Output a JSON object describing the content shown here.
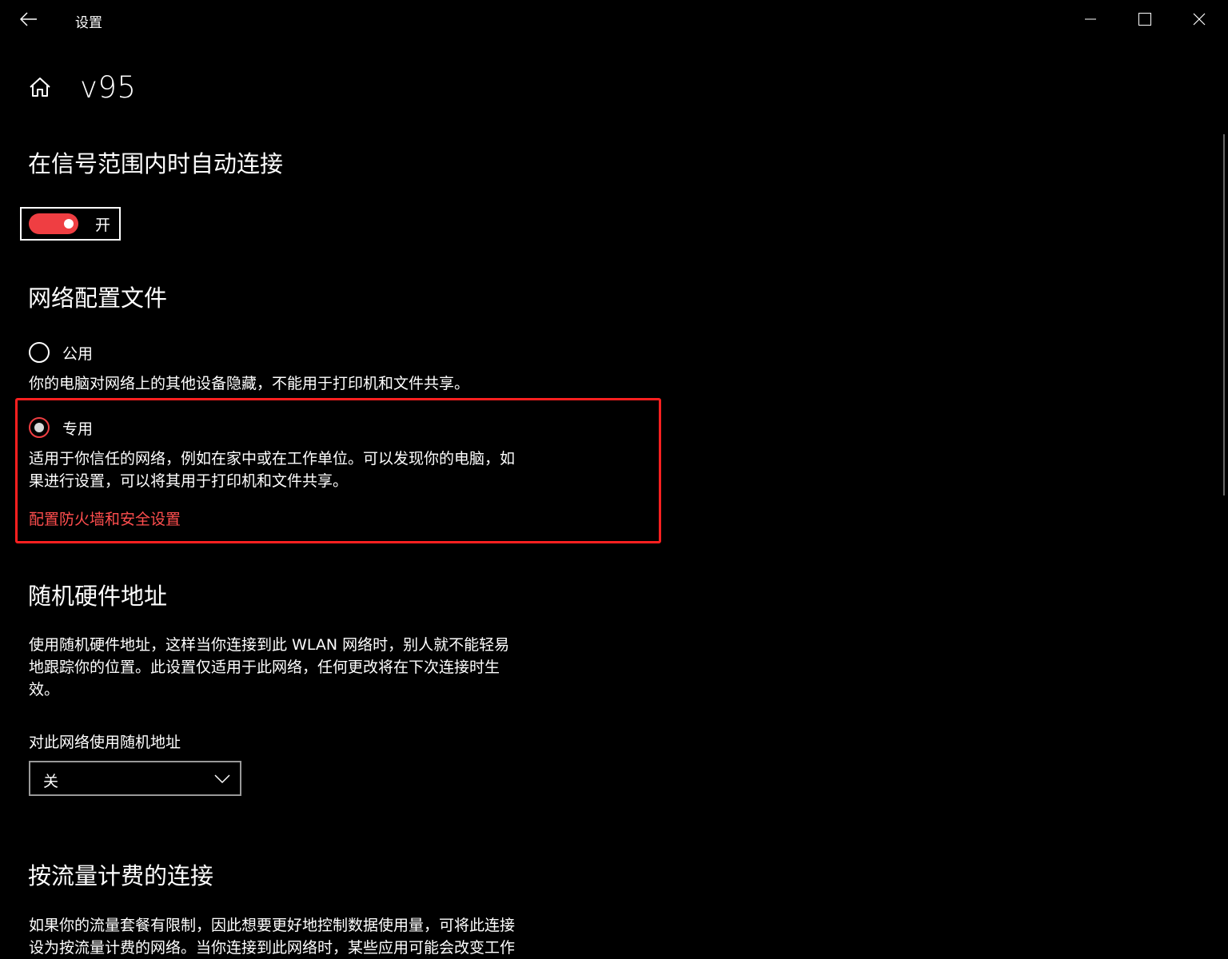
{
  "window": {
    "title": "设置",
    "back_icon": "arrow-left-icon",
    "minimize_icon": "minimize-icon",
    "maximize_icon": "maximize-icon",
    "close_icon": "close-icon"
  },
  "header": {
    "home_icon": "home-icon",
    "title": "v95"
  },
  "auto_connect": {
    "heading": "在信号范围内时自动连接",
    "toggle_state": "on",
    "toggle_label": "开",
    "accent_color": "#ef3e42"
  },
  "network_profile": {
    "heading": "网络配置文件",
    "options": [
      {
        "label": "公用",
        "selected": false,
        "description": "你的电脑对网络上的其他设备隐藏，不能用于打印机和文件共享。"
      },
      {
        "label": "专用",
        "selected": true,
        "description_line1": "适用于你信任的网络，例如在家中或在工作单位。可以发现你的电脑，如",
        "description_line2": "果进行设置，可以将其用于打印机和文件共享。"
      }
    ],
    "firewall_link": "配置防火墙和安全设置",
    "highlight_color": "#ff2020"
  },
  "random_hw": {
    "heading": "随机硬件地址",
    "description_line1": "使用随机硬件地址，这样当你连接到此 WLAN 网络时，别人就不能轻易",
    "description_line2": "地跟踪你的位置。此设置仅适用于此网络，任何更改将在下次连接时生",
    "description_line3": "效。",
    "select_label": "对此网络使用随机地址",
    "select_value": "关",
    "select_icon": "chevron-down-icon"
  },
  "metered": {
    "heading": "按流量计费的连接",
    "description_line1": "如果你的流量套餐有限制，因此想要更好地控制数据使用量，可将此连接",
    "description_line2": "设为按流量计费的网络。当你连接到此网络时，某些应用可能会改变工作"
  }
}
